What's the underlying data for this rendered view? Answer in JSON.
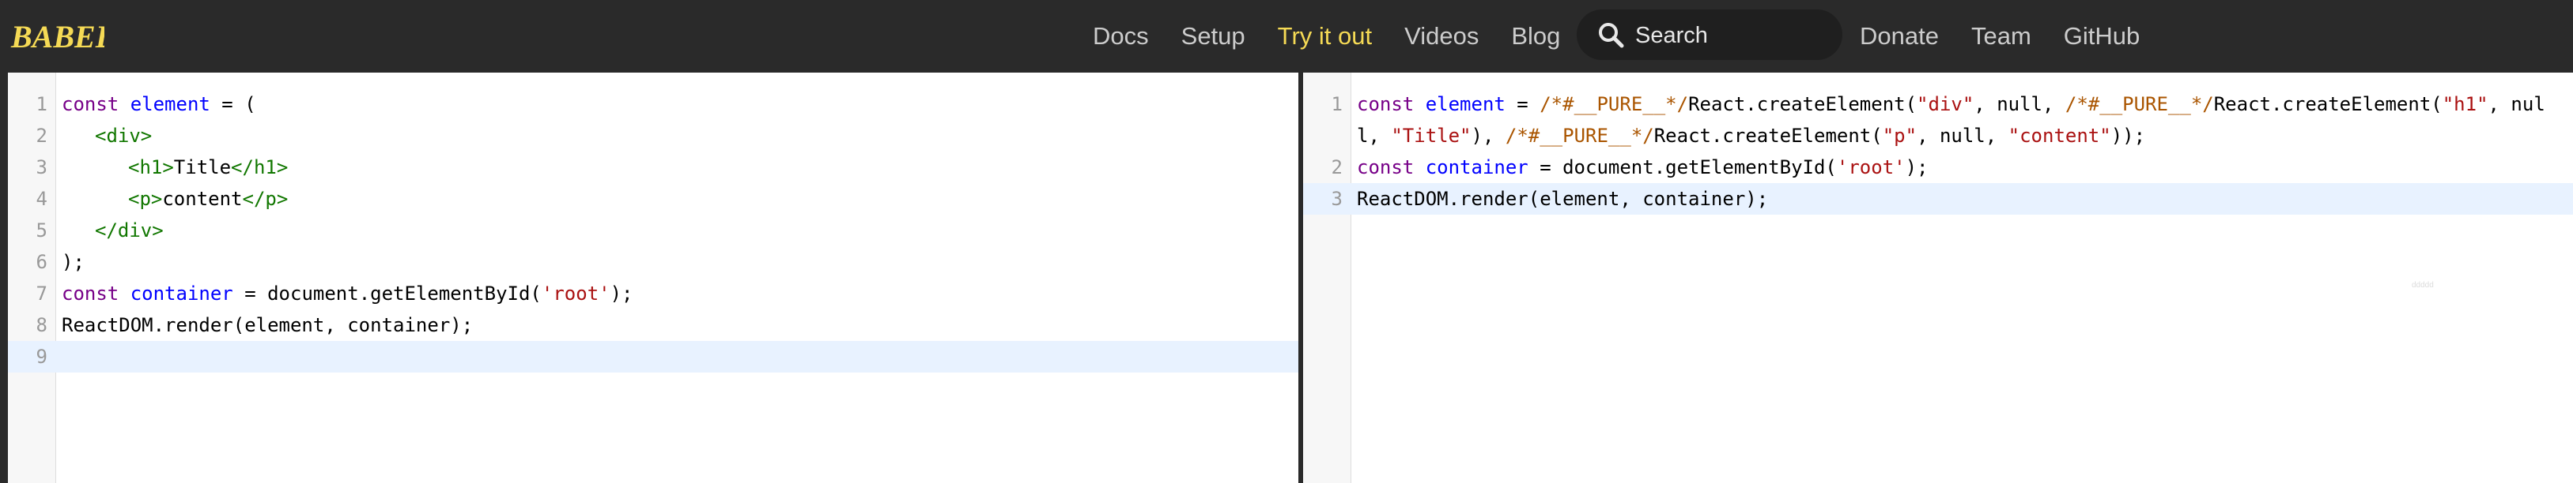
{
  "header": {
    "nav_left": [
      "Docs",
      "Setup",
      "Try it out",
      "Videos",
      "Blog"
    ],
    "active_nav": "Try it out",
    "search": {
      "placeholder": "Search"
    },
    "nav_right": [
      "Donate",
      "Team",
      "GitHub"
    ],
    "logo_text": "BABEL",
    "colors": {
      "background": "#2a2a2a",
      "accent": "#f5da55",
      "link": "#cccccc"
    }
  },
  "input_editor": {
    "line_numbers": [
      "1",
      "2",
      "3",
      "4",
      "5",
      "6",
      "7",
      "8",
      "9"
    ],
    "lines": [
      {
        "kw1": "const",
        "def1": "element",
        "rest": " = ("
      },
      {
        "tag1": "<div>"
      },
      {
        "tag1": "<h1>",
        "txt1": "Title",
        "tag2": "</h1>"
      },
      {
        "tag1": "<p>",
        "txt1": "content",
        "tag2": "</p>"
      },
      {
        "tag1": "</div>"
      },
      {
        "rest": ");"
      },
      {
        "kw1": "const",
        "def1": "container",
        "rest": " = document.getElementById(",
        "str1": "'root'",
        "rest2": ");"
      },
      {
        "rest": "ReactDOM.render(element, container);"
      },
      {
        "rest": ""
      }
    ]
  },
  "output_editor": {
    "line_numbers": [
      "1",
      "2",
      "3"
    ],
    "line1": {
      "kw1": "const",
      "def1": "element",
      "p1": " = ",
      "cm1": "/*#__PURE__*/",
      "p2": "React.createElement(",
      "str1": "\"div\"",
      "p3": ", null, ",
      "cm2": "/*#__PURE__*/",
      "p4": "React.createElement(",
      "str2": "\"h1\"",
      "p5": ", null, ",
      "str3": "\"Title\"",
      "p6": "), ",
      "cm3": "/*#__PURE__*/",
      "p7": "React.createElement(",
      "str4": "\"p\"",
      "p8": ", null, ",
      "str5": "\"content\"",
      "p9": "));"
    },
    "line2": {
      "kw1": "const",
      "def1": "container",
      "p1": " = document.getElementById(",
      "str1": "'root'",
      "p2": ");"
    },
    "line3": {
      "p1": "ReactDOM.render(element, container);"
    },
    "minimap_text": "ddddd"
  }
}
